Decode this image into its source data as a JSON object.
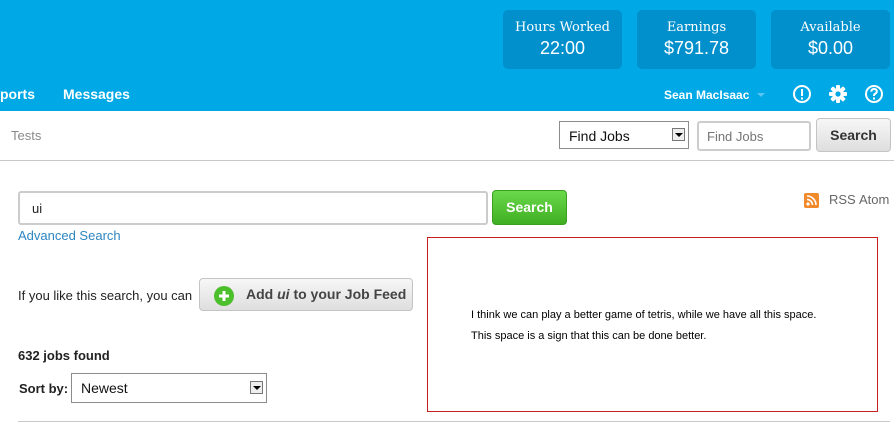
{
  "stats": {
    "hours_worked_label": "Hours Worked",
    "hours_worked_value": "22:00",
    "earnings_label": "Earnings",
    "earnings_value": "$791.78",
    "available_label": "Available",
    "available_value": "$0.00"
  },
  "nav": {
    "reports": "ports",
    "messages": "Messages",
    "user": "Sean MacIsaac"
  },
  "subnav": {
    "tests": "Tests",
    "find_select": "Find Jobs",
    "find_placeholder": "Find Jobs",
    "search_button": "Search"
  },
  "main": {
    "search_value": "ui",
    "search_button": "Search",
    "advanced_search": "Advanced Search",
    "rss_label": "RSS",
    "atom_label": "Atom",
    "like_text": "If you like this search, you can",
    "feed_add": "Add",
    "feed_term": "ui",
    "feed_rest": "to your Job Feed",
    "jobs_found": "632 jobs found",
    "sort_label": "Sort by:",
    "sort_value": "Newest"
  },
  "note": {
    "line1": "I think we can play a better game of tetris, while we have all this space.",
    "line2": "This space is a sign that this can be done better."
  },
  "colors": {
    "header_blue": "#00a8e6",
    "stat_box": "#0190cc",
    "green_button": "#4cbf2c",
    "link_blue": "#2e86c1",
    "note_border": "#c81e1e",
    "rss_orange": "#f18a2a"
  }
}
